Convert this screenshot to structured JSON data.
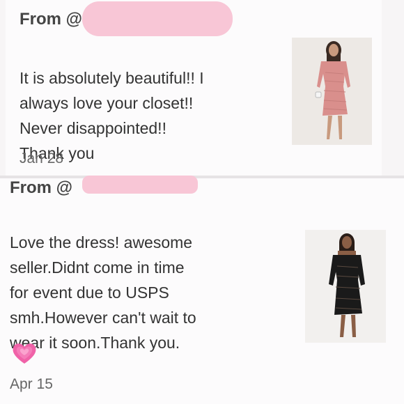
{
  "reviews": [
    {
      "from_label": "From @",
      "message": "It is absolutely beautiful!! I\nalways love your closet!!\nNever disappointed!!\nThank you",
      "emoji": "two-hearts",
      "date": "Jan 28",
      "dress_color": "#d98f8c"
    },
    {
      "from_label": "From @",
      "message": "Love the dress! awesome\nseller.Didnt come in time\nfor event due to USPS\nsmh.However can't wait to\nwear it soon.Thank you.",
      "emoji": "growing-heart",
      "date": "Apr 15",
      "dress_color": "#1a1a1a"
    }
  ],
  "colors": {
    "redaction": "#f8c6d6",
    "heart": "#f062a8"
  }
}
